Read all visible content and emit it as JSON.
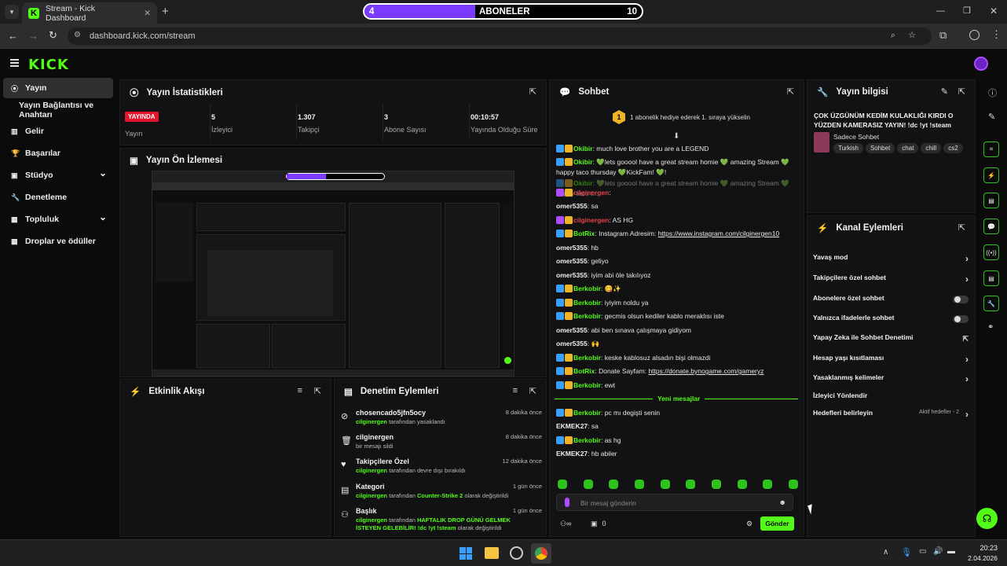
{
  "browser": {
    "tab_title": "Stream - Kick Dashboard",
    "new_tab": "+",
    "url": "dashboard.kick.com/stream"
  },
  "overlay": {
    "left": "4",
    "label": "ABONELER",
    "right": "10",
    "progress": 0.4
  },
  "kick": {
    "logo": "KICK"
  },
  "sidebar": [
    {
      "label": "Yayın",
      "icon": "stream-icon",
      "active": true
    },
    {
      "label": "Yayın Bağlantısı ve Anahtarı",
      "icon": "",
      "sub": true
    },
    {
      "label": "Gelir",
      "icon": "revenue-icon"
    },
    {
      "label": "Başarılar",
      "icon": "trophy-icon"
    },
    {
      "label": "Stüdyo",
      "icon": "studio-icon",
      "chev": true
    },
    {
      "label": "Denetleme",
      "icon": "wrench-icon"
    },
    {
      "label": "Topluluk",
      "icon": "community-icon",
      "chev": true
    },
    {
      "label": "Droplar ve ödüller",
      "icon": "drops-icon"
    }
  ],
  "stats": {
    "title": "Yayın İstatistikleri",
    "live_badge": "YAYINDA",
    "live_label": "Yayın",
    "items": [
      {
        "value": "5",
        "label": "İzleyici"
      },
      {
        "value": "1.307",
        "label": "Takipçi"
      },
      {
        "value": "3",
        "label": "Abone Sayısı"
      },
      {
        "value": "00:10:57",
        "label": "Yayında Olduğu Süre"
      }
    ]
  },
  "preview": {
    "title": "Yayın Ön İzlemesi"
  },
  "activity": {
    "title": "Etkinlik Akışı"
  },
  "moderation": {
    "title": "Denetim Eylemleri",
    "rows": [
      {
        "title": "chosencado5jfn5ocy",
        "user": "cilginergen",
        "text": " tarafından yasaklandı",
        "time": "8 dakika önce",
        "icon": "ban-icon"
      },
      {
        "title": "cilginergen",
        "user": "",
        "text": "bir mesajı sildi",
        "time": "8 dakika önce",
        "icon": "trash-icon"
      },
      {
        "title": "Takipçilere Özel",
        "user": "cilginergen",
        "text": " tarafından devre dışı bırakıldı",
        "time": "12 dakika önce",
        "icon": "heart-icon"
      },
      {
        "title": "Kategori",
        "user": "cilginergen",
        "text": " tarafından ",
        "extra": "Counter-Strike 2",
        "text2": " olarak değiştirildi",
        "time": "1 gün önce",
        "icon": "category-icon"
      },
      {
        "title": "Başlık",
        "user": "cilginergen",
        "text": " tarafından ",
        "extra": "HAFTALIK DROP GÜNÜ GELMEK İSTEYEN GELEBİLİR! !dc !yt !steam",
        "text2": " olarak değiştirildi",
        "time": "1 gün önce",
        "icon": "title-icon"
      }
    ]
  },
  "chat": {
    "title": "Sohbet",
    "gift": "1 abonelik hediye ederek 1. sıraya yükselin",
    "new_messages": "Yeni mesajlar",
    "placeholder": "Bir mesaj gönderin",
    "send": "Gönder",
    "bottom_count": "0",
    "messages": [
      {
        "user": "Okibir",
        "color": "g",
        "text": "much love brother you are a LEGEND"
      },
      {
        "user": "Okibir",
        "color": "g",
        "text": "💚lets gooool have a great stream homie 💚 amazing Stream 💚 happy taco thursday 💚KickFam! 💚!"
      },
      {
        "user": "Okibir",
        "color": "dim",
        "text": "💚lets gooool have a great stream homie 💚 amazing Stream 💚 happy taco t..."
      },
      {
        "user": "cilginergen",
        "color": "r",
        "text": ""
      },
      {
        "user": "omer5355",
        "color": "w",
        "text": "sa"
      },
      {
        "user": "cilginergen",
        "color": "r",
        "text": "AS HG"
      },
      {
        "user": "BotRix",
        "color": "g",
        "text": "Instagram Adresim: ",
        "link": "https://www.instagram.com/cilginergen10"
      },
      {
        "user": "omer5355",
        "color": "w",
        "text": "hb"
      },
      {
        "user": "omer5355",
        "color": "w",
        "text": "geliyo"
      },
      {
        "user": "omer5355",
        "color": "w",
        "text": "iyim abi öle takılıyoz"
      },
      {
        "user": "Berkobir",
        "color": "g",
        "text": "😋✨"
      },
      {
        "user": "Berkobir",
        "color": "g",
        "text": "iyiyim noldu ya"
      },
      {
        "user": "Berkobir",
        "color": "g",
        "text": "gecmis olsun kediler kablo meraklısı iste"
      },
      {
        "user": "omer5355",
        "color": "w",
        "text": "abi ben sınava çalışmaya gidiyom"
      },
      {
        "user": "omer5355",
        "color": "w",
        "text": "🙌"
      },
      {
        "user": "Berkobir",
        "color": "g",
        "text": "keske kablosuz alsadın bişi olmazdi"
      },
      {
        "user": "BotRix",
        "color": "g",
        "text": "Donate Sayfam: ",
        "link": "https://donate.bynogame.com/gameryz"
      },
      {
        "user": "Berkobir",
        "color": "g",
        "text": "ewt"
      },
      {
        "user": "Berkobir",
        "color": "g",
        "text": "pc mı degişti senin"
      },
      {
        "user": "EKMEK27",
        "color": "w",
        "text": "sa"
      },
      {
        "user": "Berkobir",
        "color": "g",
        "text": "as hg"
      },
      {
        "user": "EKMEK27",
        "color": "w",
        "text": "hb abiler"
      }
    ]
  },
  "info": {
    "title": "Yayın bilgisi",
    "stream_title": "ÇOK ÜZGÜNÜM KEDİM KULAKLIĞI KIRDI O YÜZDEN KAMERASIZ YAYIN! !dc !yt !steam",
    "mode": "Sadece Sohbet",
    "tags": [
      "Turkish",
      "Sohbet",
      "chat",
      "chill",
      "cs2"
    ]
  },
  "channel_actions": {
    "title": "Kanal Eylemleri",
    "rows": [
      {
        "label": "Yavaş mod",
        "type": "chev"
      },
      {
        "label": "Takipçilere özel sohbet",
        "type": "chev"
      },
      {
        "label": "Abonelere özel sohbet",
        "type": "toggle"
      },
      {
        "label": "Yalnızca ifadelerle sohbet",
        "type": "toggle"
      },
      {
        "label": "Yapay Zeka ile Sohbet Denetimi",
        "type": "ext"
      },
      {
        "label": "Hesap yaşı kısıtlaması",
        "type": "chev"
      },
      {
        "label": "Yasaklanmış kelimeler",
        "type": "chev"
      },
      {
        "label": "İzleyici Yönlendir",
        "type": "none"
      },
      {
        "label": "Hedefleri belirleyin",
        "type": "chev",
        "extra": "Aktif hedefler - 2"
      }
    ]
  },
  "taskbar": {
    "time": "20:23",
    "date": "2.04.2026"
  },
  "colors": {
    "kick_green": "#53fc18",
    "live_red": "#e2152c",
    "sub_purple": "#7b3bff"
  }
}
